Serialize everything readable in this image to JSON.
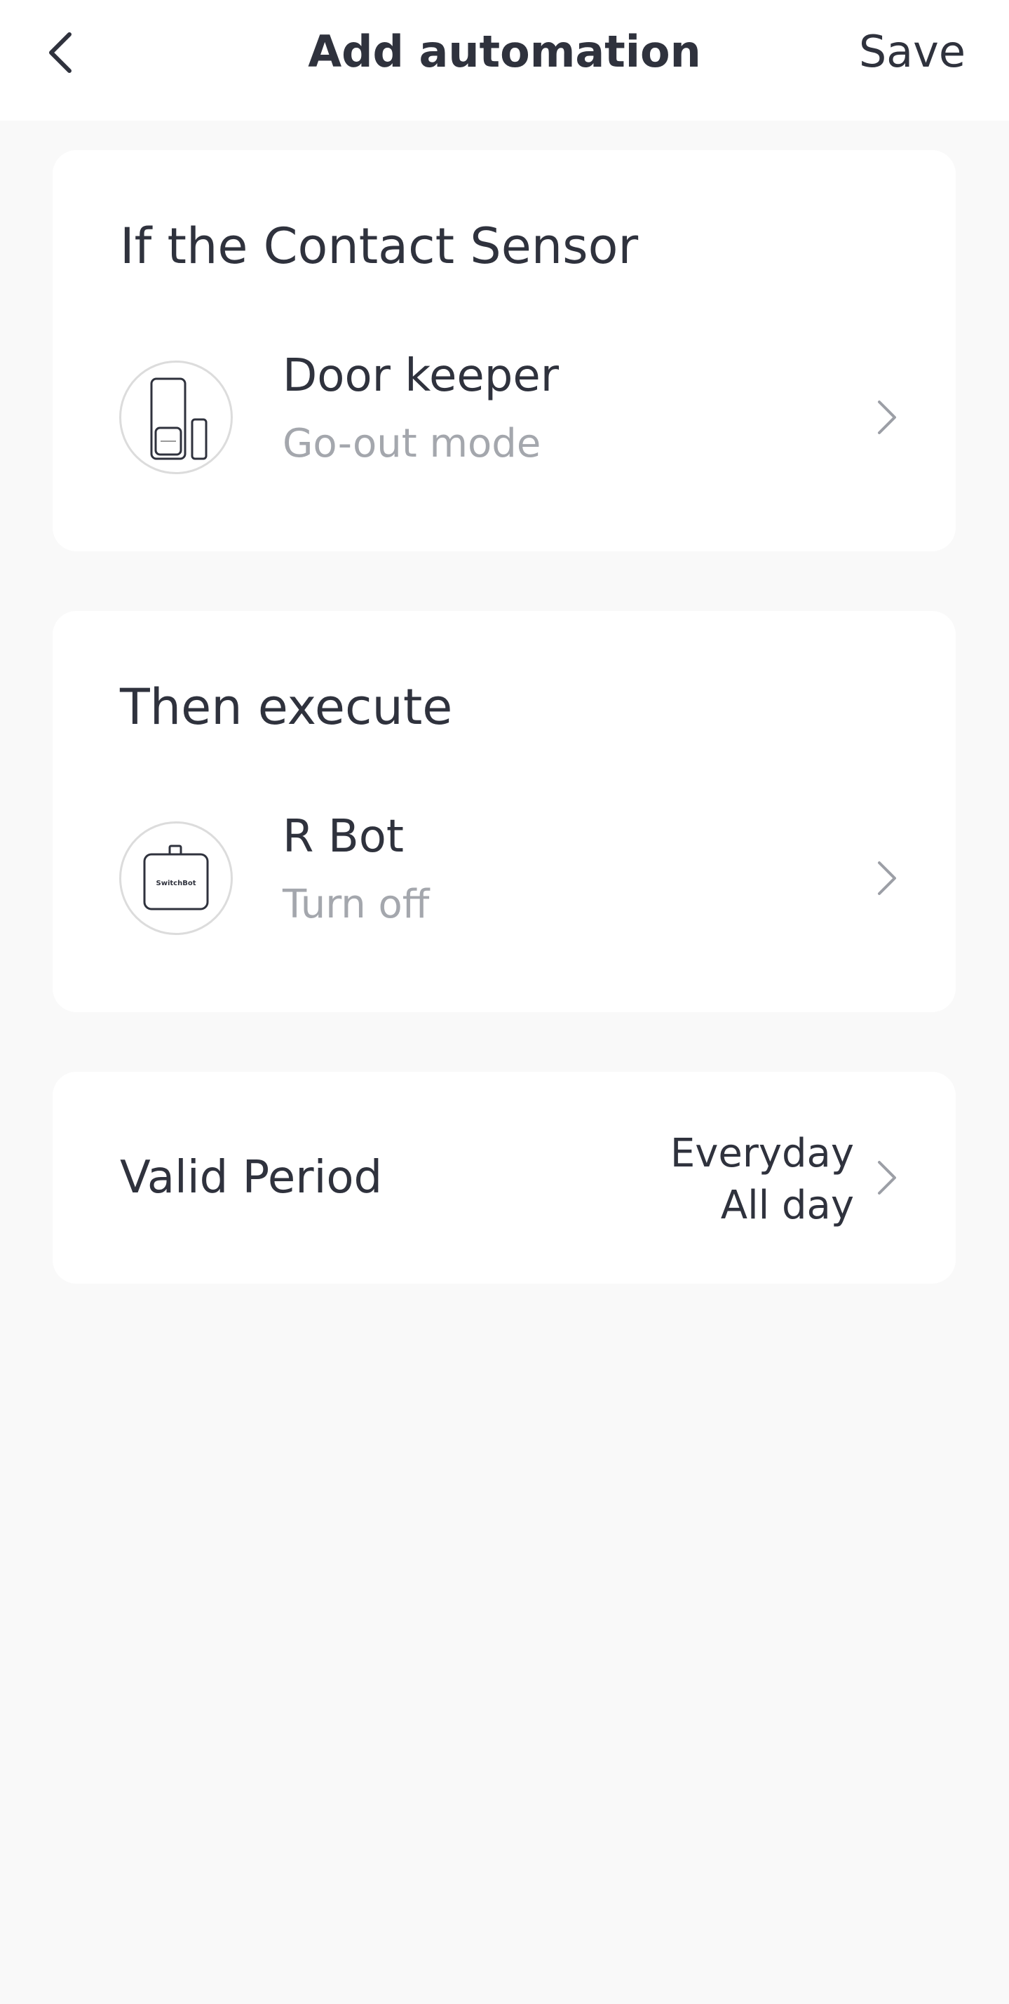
{
  "header": {
    "back_icon": "chevron-left-icon",
    "title": "Add automation",
    "save_label": "Save"
  },
  "trigger": {
    "heading": "If the Contact Sensor",
    "device": {
      "icon": "contact-sensor-icon",
      "name": "Door keeper",
      "state": "Go-out mode"
    }
  },
  "action": {
    "heading": "Then execute",
    "device": {
      "icon": "switchbot-bot-icon",
      "icon_text": "SwitchBot",
      "name": "R Bot",
      "state": "Turn off"
    }
  },
  "valid_period": {
    "label": "Valid Period",
    "days": "Everyday",
    "time": "All day"
  },
  "colors": {
    "background": "#f9f9f9",
    "card": "#ffffff",
    "text_primary": "#2f323d",
    "text_secondary": "#a4a7ad",
    "chevron": "#9c9fa6"
  }
}
